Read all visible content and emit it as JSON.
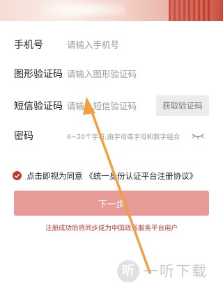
{
  "form": {
    "phone": {
      "label": "手机号",
      "placeholder": "请输入手机号"
    },
    "captcha": {
      "label": "图形验证码",
      "placeholder": "请输入图形验证码"
    },
    "sms": {
      "label": "短信验证码",
      "placeholder": "请输入短信验证码",
      "button_label": "获取验证码"
    },
    "password": {
      "label": "密码",
      "placeholder": "6~20个字符,由字母或字母和数字组合"
    }
  },
  "agreement": {
    "text": "点击即视为同意 《统一身份认证平台注册协议》",
    "checked": true
  },
  "next_button": {
    "label": "下一步"
  },
  "sync_note": "注册成功后将同步成为中国政务服务平台用户",
  "watermark": {
    "logo_glyph": "听",
    "text": "一听下载"
  },
  "colors": {
    "accent": "#c0392b",
    "button_bg": "#e69b96",
    "note_text": "#b53a32",
    "arrow": "#f0a040"
  },
  "icons": [
    "eye-closed-icon",
    "check-circle-icon",
    "annotation-arrow-icon"
  ]
}
